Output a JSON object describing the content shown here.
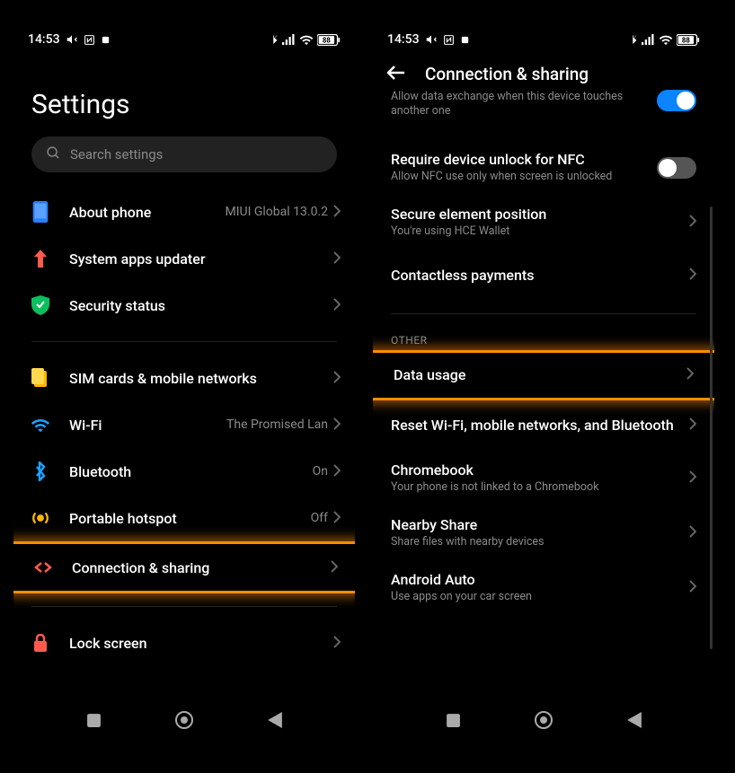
{
  "statusbar": {
    "time": "14:53",
    "battery": "88"
  },
  "screen1": {
    "title": "Settings",
    "search_placeholder": "Search settings",
    "rows": {
      "about": {
        "label": "About phone",
        "value": "MIUI Global 13.0.2"
      },
      "updater": {
        "label": "System apps updater"
      },
      "security": {
        "label": "Security status"
      },
      "sim": {
        "label": "SIM cards & mobile networks"
      },
      "wifi": {
        "label": "Wi-Fi",
        "value": "The Promised Lan"
      },
      "bluetooth": {
        "label": "Bluetooth",
        "value": "On"
      },
      "hotspot": {
        "label": "Portable hotspot",
        "value": "Off"
      },
      "connection": {
        "label": "Connection & sharing"
      },
      "lock": {
        "label": "Lock screen"
      }
    }
  },
  "screen2": {
    "header": "Connection & sharing",
    "rows": {
      "nfc": {
        "sub": "Allow data exchange when this device touches another one"
      },
      "unlock": {
        "label": "Require device unlock for NFC",
        "sub": "Allow NFC use only when screen is unlocked"
      },
      "secure": {
        "label": "Secure element position",
        "sub": "You're using HCE Wallet"
      },
      "contactless": {
        "label": "Contactless payments"
      },
      "section_other": "OTHER",
      "data": {
        "label": "Data usage"
      },
      "reset": {
        "label": "Reset Wi-Fi, mobile networks, and Bluetooth"
      },
      "chromebook": {
        "label": "Chromebook",
        "sub": "Your phone is not linked to a Chromebook"
      },
      "nearby": {
        "label": "Nearby Share",
        "sub": "Share files with nearby devices"
      },
      "auto": {
        "label": "Android Auto",
        "sub": "Use apps on your car screen"
      }
    }
  }
}
